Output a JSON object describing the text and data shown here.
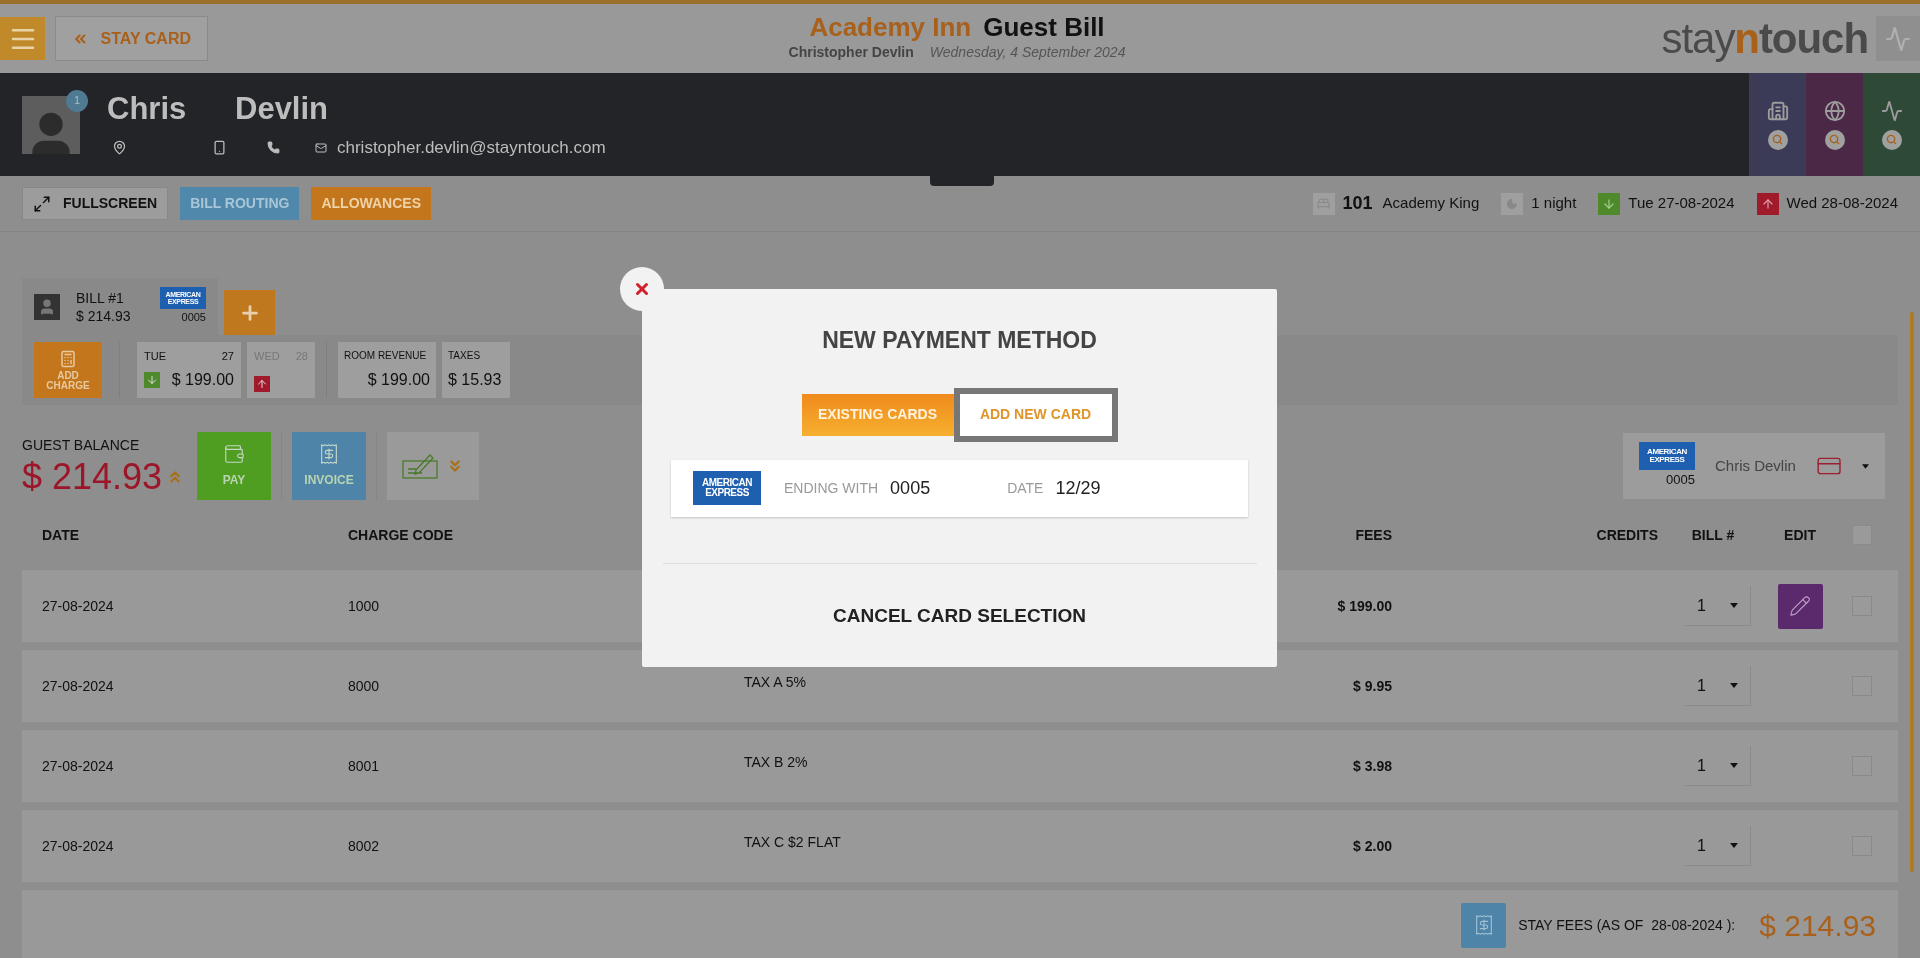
{
  "top_bar": {
    "back_button": "STAY CARD",
    "hotel": "Academy Inn",
    "title": "Guest Bill",
    "guest": "Christopher Devlin",
    "date": "Wednesday, 4 September 2024",
    "logo": [
      "stay",
      "n",
      "touch"
    ]
  },
  "guest": {
    "first_name": "Chris",
    "last_name": "Devlin",
    "badge": "1",
    "email": "christopher.devlin@stayntouch.com"
  },
  "toolbar": {
    "buttons": [
      {
        "label": "FULLSCREEN",
        "kind": "fullscreen"
      },
      {
        "label": "BILL ROUTING",
        "kind": "blue"
      },
      {
        "label": "ALLOWANCES",
        "kind": "orange"
      }
    ],
    "room_number": "101",
    "room_type": "Academy King",
    "nights": "1 night",
    "arrival": "Tue 27-08-2024",
    "departure": "Wed 28-08-2024"
  },
  "bill_tabs": [
    {
      "label": "BILL #1",
      "amount": "$ 214.93",
      "card_brand": "AMERICAN EXPRESS",
      "card_number": "0005",
      "selected": true
    }
  ],
  "add_charge": "ADD CHARGE",
  "days": [
    {
      "day": "TUE",
      "date": "27",
      "amount": "$ 199.00",
      "kind": "arrival"
    },
    {
      "day": "WED",
      "date": "28",
      "kind": "departure"
    }
  ],
  "totals": [
    {
      "label": "ROOM REVENUE",
      "amount": "$ 199.00"
    },
    {
      "label": "TAXES",
      "amount": "$ 15.93"
    }
  ],
  "balance": {
    "label": "GUEST BALANCE",
    "amount": "$ 214.93"
  },
  "actions": [
    {
      "label": "PAY",
      "kind": "pay"
    },
    {
      "label": "INVOICE",
      "kind": "invoice"
    }
  ],
  "payment": {
    "card_brand": "AMERICAN EXPRESS",
    "card_number": "0005",
    "name": "Chris Devlin"
  },
  "table": {
    "columns": [
      "DATE",
      "CHARGE CODE",
      "FEES",
      "CREDITS",
      "BILL #",
      "EDIT"
    ],
    "select_all_checked": false,
    "rows": [
      {
        "date": "27-08-2024",
        "code": "1000",
        "fees": "$ 199.00",
        "bill": "1",
        "editable": true,
        "checked": false
      },
      {
        "date": "27-08-2024",
        "code": "8000",
        "description": "TAX A 5%",
        "fees": "$ 9.95",
        "bill": "1",
        "editable": false,
        "checked": false
      },
      {
        "date": "27-08-2024",
        "code": "8001",
        "description": "TAX B 2%",
        "fees": "$ 3.98",
        "bill": "1",
        "editable": false,
        "checked": false
      },
      {
        "date": "27-08-2024",
        "code": "8002",
        "description": "TAX C $2 FLAT",
        "fees": "$ 2.00",
        "bill": "1",
        "editable": false,
        "checked": false
      }
    ]
  },
  "stay_fees": {
    "label": "STAY FEES (AS OF  28-08-2024 ):",
    "amount": "$ 214.93"
  },
  "modal": {
    "title": "NEW PAYMENT METHOD",
    "tabs": [
      {
        "label": "EXISTING CARDS",
        "selected": true,
        "hovered": false
      },
      {
        "label": "ADD NEW CARD",
        "selected": false,
        "hovered": true
      }
    ],
    "card": {
      "card_brand": "AMERICAN EXPRESS",
      "ending_label": "ENDING WITH",
      "ending": "0005",
      "date_label": "DATE",
      "date": "12/29"
    },
    "cancel": "CANCEL CARD SELECTION"
  }
}
